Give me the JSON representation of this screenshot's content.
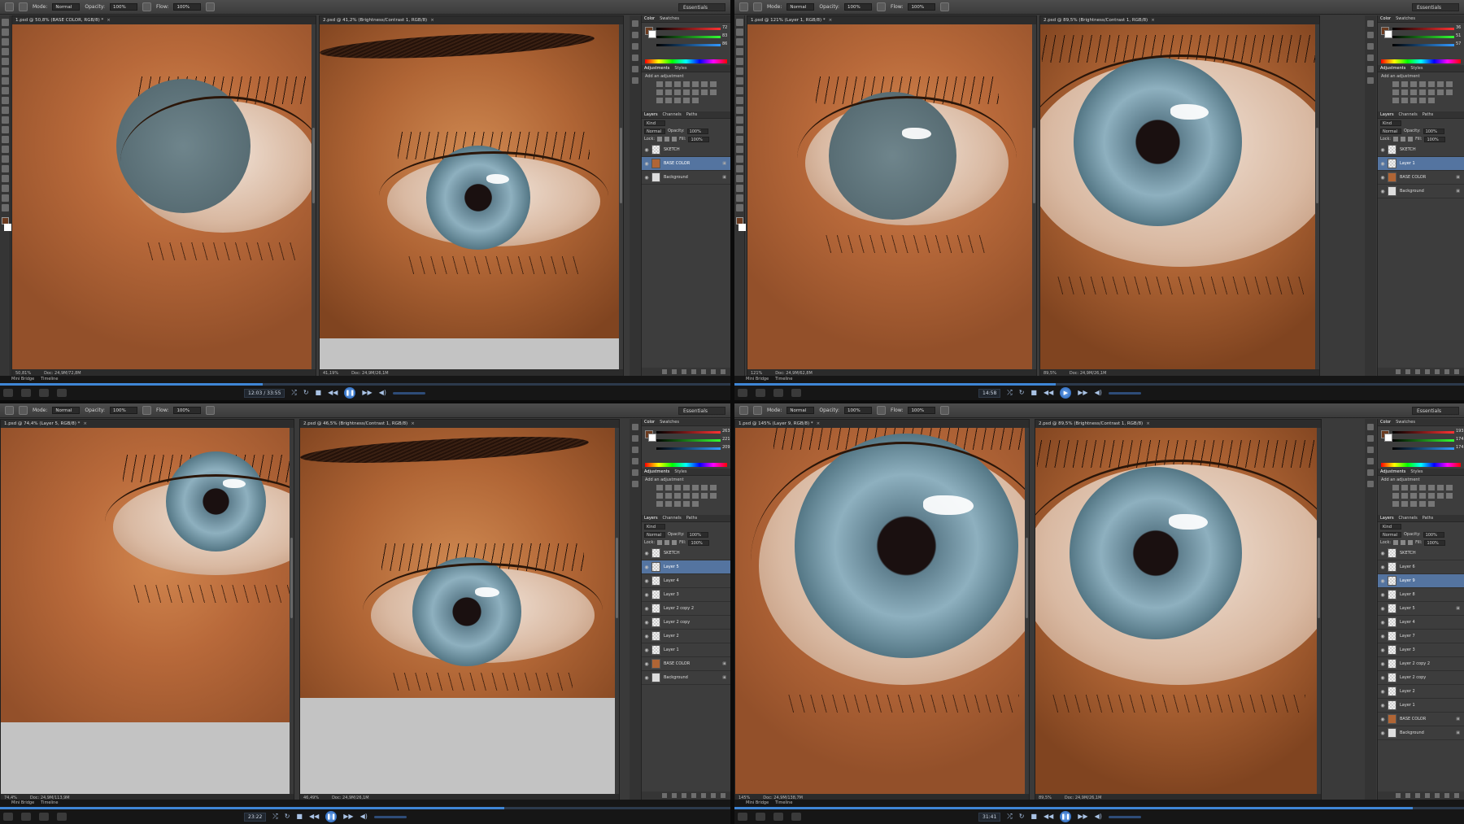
{
  "options_bar": {
    "mode_label": "Mode:",
    "mode_value": "Normal",
    "opacity_label": "Opacity:",
    "opacity_value": "100%",
    "flow_label": "Flow:",
    "flow_value": "100%",
    "workspace": "Essentials"
  },
  "panel_tabs": {
    "color": "Color",
    "swatches": "Swatches",
    "adjustments": "Adjustments",
    "styles": "Styles",
    "add_adjustment": "Add an adjustment",
    "layers": "Layers",
    "channels": "Channels",
    "paths": "Paths",
    "kind": "Kind",
    "blend": "Normal",
    "opacity_label": "Opacity:",
    "opacity_value": "100%",
    "lock_label": "Lock:",
    "fill_label": "Fill:",
    "fill_value": "100%"
  },
  "bottom": {
    "mini_bridge": "Mini Bridge",
    "timeline": "Timeline"
  },
  "quads": [
    {
      "tab_painting": "1.psd @ 50,8% (BASE COLOR, RGB/8) *",
      "tab_reference": "2.psd @ 41,2% (Brightness/Contrast 1, RGB/8)",
      "status_painting_zoom": "50,81%",
      "status_painting_doc": "Doc: 24,9M/72,8M",
      "status_reference_zoom": "41,19%",
      "status_reference_doc": "Doc: 24,9M/26,1M",
      "color_values": [
        "72",
        "83",
        "86"
      ],
      "time": "12:03 / 33:55",
      "progress": 0.36,
      "layers": [
        {
          "name": "SKETCH",
          "selected": false,
          "thumb": "empty",
          "locked": false
        },
        {
          "name": "BASE COLOR",
          "selected": true,
          "thumb": "base",
          "locked": true
        },
        {
          "name": "Background",
          "selected": false,
          "thumb": "bg",
          "locked": true
        }
      ]
    },
    {
      "tab_painting": "1.psd @ 121% (Layer 1, RGB/8) *",
      "tab_reference": "2.psd @ 89,5% (Brightness/Contrast 1, RGB/8)",
      "status_painting_zoom": "121%",
      "status_painting_doc": "Doc: 24,9M/62,8M",
      "status_reference_zoom": "89,5%",
      "status_reference_doc": "Doc: 24,9M/26,1M",
      "color_values": [
        "36",
        "51",
        "57"
      ],
      "time": "14:58",
      "progress": 0.44,
      "layers": [
        {
          "name": "SKETCH",
          "selected": false,
          "thumb": "empty",
          "locked": false
        },
        {
          "name": "Layer 1",
          "selected": true,
          "thumb": "empty",
          "locked": false
        },
        {
          "name": "BASE COLOR",
          "selected": false,
          "thumb": "base",
          "locked": true
        },
        {
          "name": "Background",
          "selected": false,
          "thumb": "bg",
          "locked": true
        }
      ]
    },
    {
      "tab_painting": "1.psd @ 74,4% (Layer 5, RGB/8) *",
      "tab_reference": "2.psd @ 46,5% (Brightness/Contrast 1, RGB/8)",
      "status_painting_zoom": "74,4%",
      "status_painting_doc": "Doc: 24,9M/113,9M",
      "status_reference_zoom": "46,49%",
      "status_reference_doc": "Doc: 24,9M/26,1M",
      "color_values": [
        "263",
        "221",
        "209"
      ],
      "time": "23:22",
      "progress": 0.69,
      "layers": [
        {
          "name": "SKETCH",
          "selected": false,
          "thumb": "empty",
          "locked": false
        },
        {
          "name": "Layer 5",
          "selected": true,
          "thumb": "empty",
          "locked": false
        },
        {
          "name": "Layer 4",
          "selected": false,
          "thumb": "empty",
          "locked": false
        },
        {
          "name": "Layer 3",
          "selected": false,
          "thumb": "empty",
          "locked": false
        },
        {
          "name": "Layer 2 copy 2",
          "selected": false,
          "thumb": "empty",
          "locked": false
        },
        {
          "name": "Layer 2 copy",
          "selected": false,
          "thumb": "empty",
          "locked": false
        },
        {
          "name": "Layer 2",
          "selected": false,
          "thumb": "empty",
          "locked": false
        },
        {
          "name": "Layer 1",
          "selected": false,
          "thumb": "empty",
          "locked": false
        },
        {
          "name": "BASE COLOR",
          "selected": false,
          "thumb": "base",
          "locked": true
        },
        {
          "name": "Background",
          "selected": false,
          "thumb": "bg",
          "locked": true
        }
      ]
    },
    {
      "tab_painting": "1.psd @ 145% (Layer 9, RGB/8) *",
      "tab_reference": "2.psd @ 89,5% (Brightness/Contrast 1, RGB/8)",
      "status_painting_zoom": "145%",
      "status_painting_doc": "Doc: 24,9M/138,7M",
      "status_reference_zoom": "89,5%",
      "status_reference_doc": "Doc: 24,9M/26,1M",
      "color_values": [
        "193",
        "174",
        "174"
      ],
      "time": "31:41",
      "progress": 0.93,
      "layers": [
        {
          "name": "SKETCH",
          "selected": false,
          "thumb": "empty",
          "locked": false
        },
        {
          "name": "Layer 6",
          "selected": false,
          "thumb": "empty",
          "locked": false
        },
        {
          "name": "Layer 9",
          "selected": true,
          "thumb": "empty",
          "locked": false
        },
        {
          "name": "Layer 8",
          "selected": false,
          "thumb": "empty",
          "locked": false
        },
        {
          "name": "Layer 5",
          "selected": false,
          "thumb": "empty",
          "locked": true
        },
        {
          "name": "Layer 4",
          "selected": false,
          "thumb": "empty",
          "locked": false
        },
        {
          "name": "Layer 7",
          "selected": false,
          "thumb": "empty",
          "locked": false
        },
        {
          "name": "Layer 3",
          "selected": false,
          "thumb": "empty",
          "locked": false
        },
        {
          "name": "Layer 2 copy 2",
          "selected": false,
          "thumb": "empty",
          "locked": false
        },
        {
          "name": "Layer 2 copy",
          "selected": false,
          "thumb": "empty",
          "locked": false
        },
        {
          "name": "Layer 2",
          "selected": false,
          "thumb": "empty",
          "locked": false
        },
        {
          "name": "Layer 1",
          "selected": false,
          "thumb": "empty",
          "locked": false
        },
        {
          "name": "BASE COLOR",
          "selected": false,
          "thumb": "base",
          "locked": true
        },
        {
          "name": "Background",
          "selected": false,
          "thumb": "bg",
          "locked": true
        }
      ]
    }
  ],
  "icons": {
    "visibility": "eye-icon",
    "lock": "lock-icon",
    "play": "play-icon",
    "pause": "pause-icon"
  },
  "colors": {
    "selected_layer": "#5474a0",
    "progress": "#3f86d6",
    "panel_bg": "#3d3d3d"
  }
}
